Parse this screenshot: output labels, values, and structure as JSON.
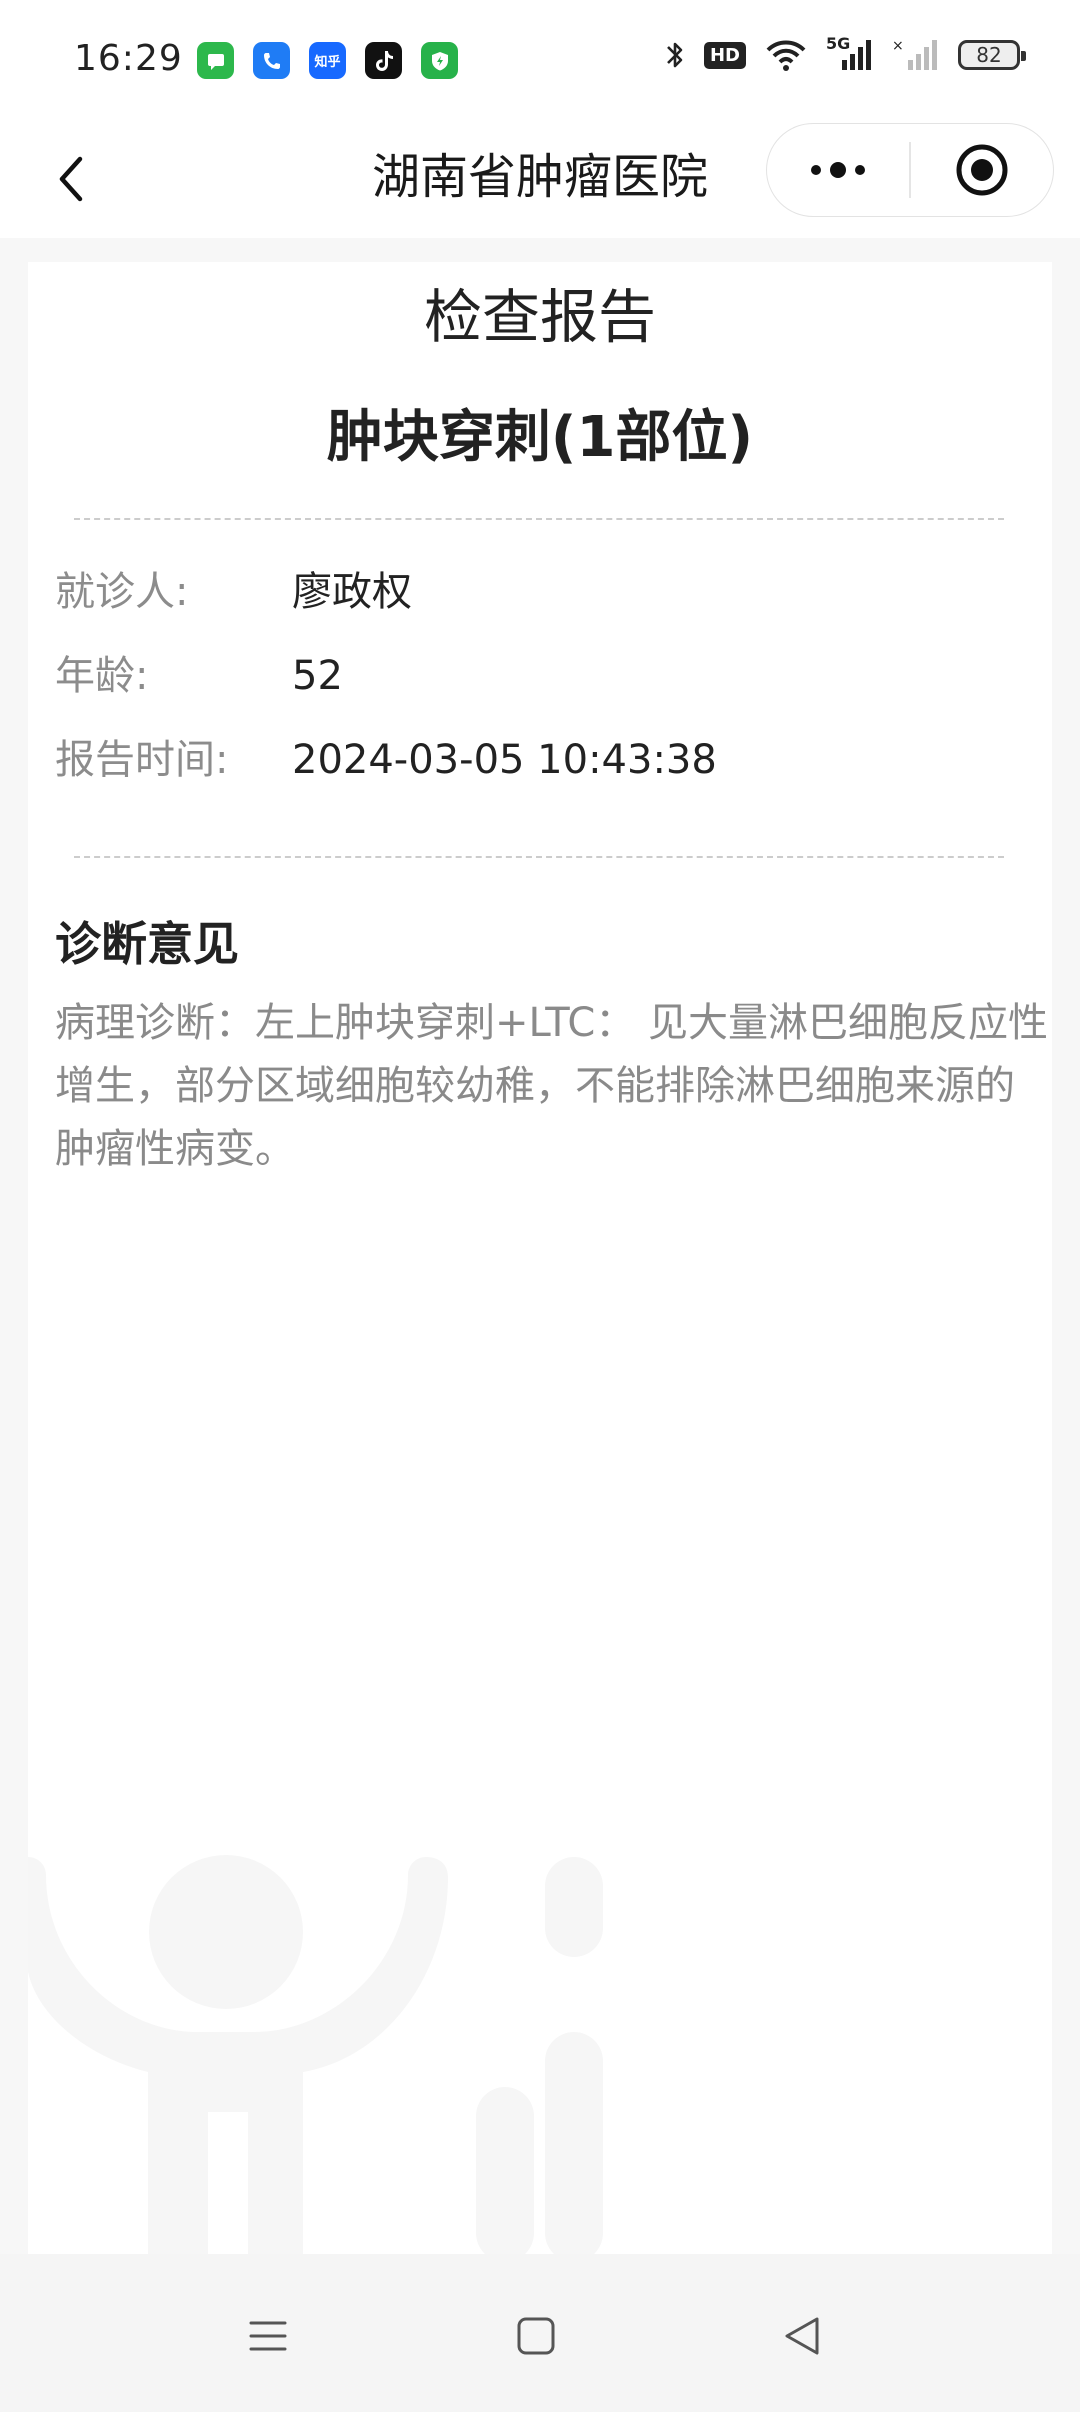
{
  "status_bar": {
    "time": "16:29",
    "app_icons": [
      {
        "name": "messages-icon",
        "color": "#2db84c"
      },
      {
        "name": "phone-icon",
        "color": "#1f7cf5"
      },
      {
        "name": "zhihu-icon",
        "color": "#1769ff",
        "text": "知乎"
      },
      {
        "name": "tiktok-icon",
        "color": "#111111"
      },
      {
        "name": "security-shield-icon",
        "color": "#27b24a"
      }
    ],
    "hd_label": "HD",
    "network": "5G",
    "battery": "82"
  },
  "nav": {
    "title": "湖南省肿瘤医院"
  },
  "report": {
    "heading": "检查报告",
    "exam_title": "肿块穿刺(1部位)",
    "patient_label": "就诊人:",
    "patient_value": "廖政权",
    "age_label": "年龄:",
    "age_value": "52",
    "time_label": "报告时间:",
    "time_value": "2024-03-05 10:43:38",
    "section_title": "诊断意见",
    "diagnosis": "病理诊断：左上肿块穿刺+LTC： 见大量淋巴细胞反应性增生，部分区域细胞较幼稚，不能排除淋巴细胞来源的肿瘤性病变。"
  }
}
